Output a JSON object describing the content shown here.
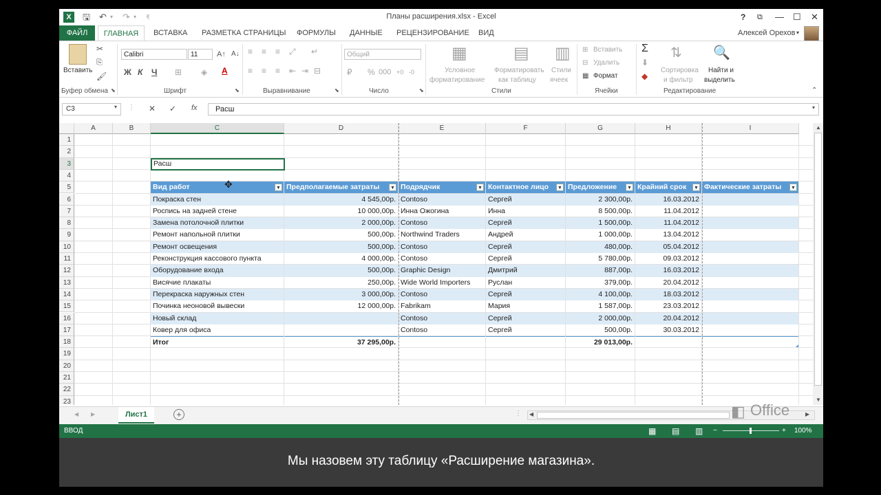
{
  "window": {
    "title": "Планы расширения.xlsx - Excel",
    "logo": "X",
    "help": "?",
    "user": "Алексей Орехов"
  },
  "tabs": {
    "file": "ФАЙЛ",
    "active": "ГЛАВНАЯ",
    "items": [
      "ВСТАВКА",
      "РАЗМЕТКА СТРАНИЦЫ",
      "ФОРМУЛЫ",
      "ДАННЫЕ",
      "РЕЦЕНЗИРОВАНИЕ",
      "ВИД"
    ]
  },
  "ribbon": {
    "paste": "Вставить",
    "clipboard": "Буфер обмена",
    "font_name": "Calibri",
    "font_size": "11",
    "font_group": "Шрифт",
    "bold": "Ж",
    "italic": "К",
    "underline": "Ч",
    "align_group": "Выравнивание",
    "number_format": "Общий",
    "number_group": "Число",
    "cond_format_1": "Условное",
    "cond_format_2": "форматирование",
    "format_table_1": "Форматировать",
    "format_table_2": "как таблицу",
    "cell_styles_1": "Стили",
    "cell_styles_2": "ячеек",
    "styles_group": "Стили",
    "insert": "Вставить",
    "delete": "Удалить",
    "format": "Формат",
    "cells_group": "Ячейки",
    "sort_1": "Сортировка",
    "sort_2": "и фильтр",
    "find_1": "Найти и",
    "find_2": "выделить",
    "edit_group": "Редактирование"
  },
  "formula": {
    "name_box": "C3",
    "fx": "fx",
    "content": "Расш"
  },
  "columns": [
    "A",
    "B",
    "C",
    "D",
    "E",
    "F",
    "G",
    "H",
    "I"
  ],
  "rows": [
    "1",
    "2",
    "3",
    "4",
    "5",
    "6",
    "7",
    "8",
    "9",
    "10",
    "11",
    "12",
    "13",
    "14",
    "15",
    "16",
    "17",
    "18",
    "19",
    "20",
    "21",
    "22",
    "23"
  ],
  "active_cell": {
    "value": "Расш"
  },
  "table": {
    "headers": [
      "Вид работ",
      "Предполагаемые затраты",
      "Подрядчик",
      "Контактное лицо",
      "Предложение",
      "Крайний срок",
      "Фактические затраты"
    ],
    "rows": [
      [
        "Покраска стен",
        "4 545,00р.",
        "Contoso",
        "Сергей",
        "2 300,00р.",
        "16.03.2012",
        ""
      ],
      [
        "Роспись на задней стене",
        "10 000,00р.",
        "Инна Ожогина",
        "Инна",
        "8 500,00р.",
        "11.04.2012",
        ""
      ],
      [
        "Замена потолочной плитки",
        "2 000,00р.",
        "Contoso",
        "Сергей",
        "1 500,00р.",
        "11.04.2012",
        ""
      ],
      [
        "Ремонт напольной плитки",
        "500,00р.",
        "Northwind Traders",
        "Андрей",
        "1 000,00р.",
        "13.04.2012",
        ""
      ],
      [
        "Ремонт освещения",
        "500,00р.",
        "Contoso",
        "Сергей",
        "480,00р.",
        "05.04.2012",
        ""
      ],
      [
        "Реконструкция кассового пункта",
        "4 000,00р.",
        "Contoso",
        "Сергей",
        "5 780,00р.",
        "09.03.2012",
        ""
      ],
      [
        "Оборудование входа",
        "500,00р.",
        "Graphic Design",
        "Дмитрий",
        "887,00р.",
        "16.03.2012",
        ""
      ],
      [
        "Висячие плакаты",
        "250,00р.",
        "Wide World Importers",
        "Руслан",
        "379,00р.",
        "20.04.2012",
        ""
      ],
      [
        "Перекраска наружных стен",
        "3 000,00р.",
        "Contoso",
        "Сергей",
        "4 100,00р.",
        "18.03.2012",
        ""
      ],
      [
        "Починка неоновой вывески",
        "12 000,00р.",
        "Fabrikam",
        "Мария",
        "1 587,00р.",
        "23.03.2012",
        ""
      ],
      [
        "Новый склад",
        "",
        "Contoso",
        "Сергей",
        "2 000,00р.",
        "20.04.2012",
        ""
      ],
      [
        "Ковер для офиса",
        "",
        "Contoso",
        "Сергей",
        "500,00р.",
        "30.03.2012",
        ""
      ]
    ],
    "total": [
      "Итог",
      "37 295,00р.",
      "",
      "",
      "29 013,00р.",
      "",
      ""
    ]
  },
  "sheet": {
    "tab": "Лист1",
    "add": "+"
  },
  "status": {
    "mode": "ВВОД",
    "zoom": "100%"
  },
  "office_logo": "Office",
  "caption": "Мы назовем эту таблицу «Расширение магазина».",
  "colors": {
    "accent": "#217346",
    "table_header": "#5b9bd5",
    "table_band": "#ddebf7"
  }
}
